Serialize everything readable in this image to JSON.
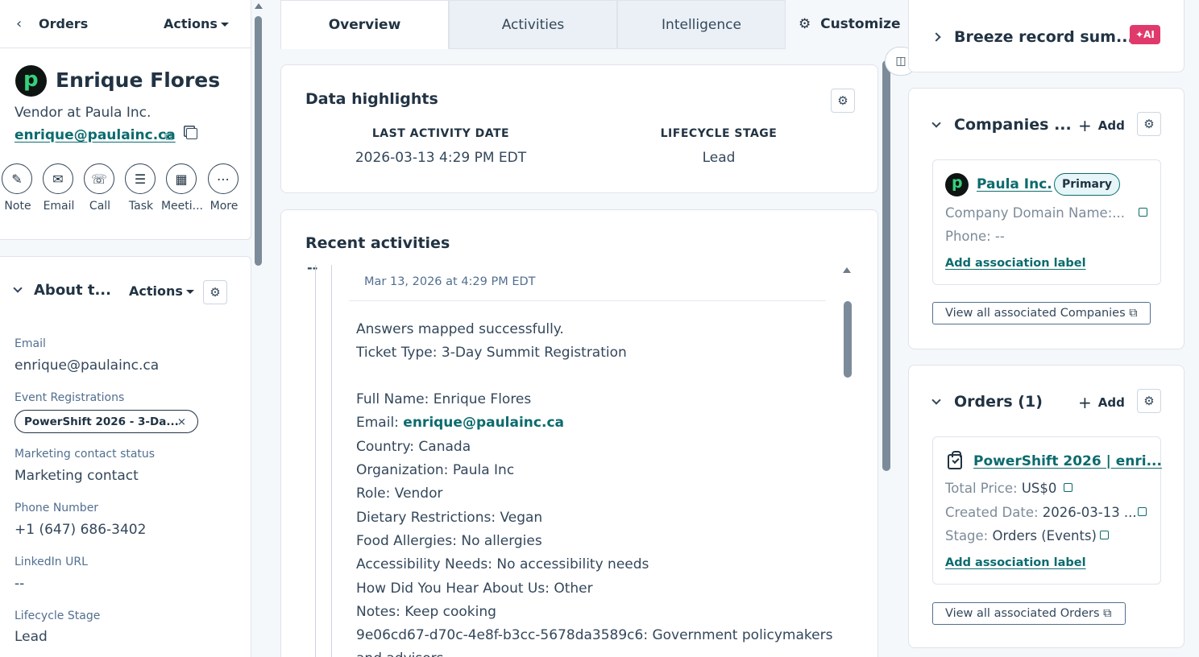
{
  "left": {
    "back_label": "Orders",
    "actions_label": "Actions",
    "contact": {
      "avatar_letter": "p",
      "name": "Enrique Flores",
      "subtitle": "Vendor at Paula Inc.",
      "email": "enrique@paulainc.ca"
    },
    "quick_actions": [
      {
        "label": "Note",
        "icon": "note-icon",
        "glyph": "✎"
      },
      {
        "label": "Email",
        "icon": "envelope-icon",
        "glyph": "✉"
      },
      {
        "label": "Call",
        "icon": "phone-icon",
        "glyph": "☏"
      },
      {
        "label": "Task",
        "icon": "task-list-icon",
        "glyph": "☰"
      },
      {
        "label": "Meeti...",
        "icon": "calendar-icon",
        "glyph": "▦"
      },
      {
        "label": "More",
        "icon": "more-dots-icon",
        "glyph": "⋯"
      }
    ],
    "about": {
      "title": "About t...",
      "actions_label": "Actions",
      "properties": {
        "email_label": "Email",
        "email_value": "enrique@paulainc.ca",
        "event_label": "Event Registrations",
        "event_tag": "PowerShift 2026 - 3-Da...",
        "marketing_label": "Marketing contact status",
        "marketing_value": "Marketing contact",
        "phone_label": "Phone Number",
        "phone_value": "+1 (647) 686-3402",
        "linkedin_label": "LinkedIn URL",
        "linkedin_value": "--",
        "lifecycle_label": "Lifecycle Stage",
        "lifecycle_value": "Lead"
      }
    }
  },
  "tabs": [
    {
      "label": "Overview",
      "active": true
    },
    {
      "label": "Activities",
      "active": false
    },
    {
      "label": "Intelligence",
      "active": false
    }
  ],
  "customize_label": "Customize",
  "highlights": {
    "title": "Data highlights",
    "last_activity_label": "LAST ACTIVITY DATE",
    "last_activity_value": "2026-03-13 4:29 PM EDT",
    "lifecycle_label": "LIFECYCLE STAGE",
    "lifecycle_value": "Lead"
  },
  "recent": {
    "title": "Recent activities",
    "dash": "--",
    "date": "Mar 13, 2026 at 4:29 PM EDT",
    "line1": "Answers mapped successfully.",
    "line2": "Ticket Type: 3-Day Summit Registration",
    "full_name": "Full Name: Enrique Flores",
    "email_prefix": "Email: ",
    "email_value": "enrique@paulainc.ca",
    "country": "Country: Canada",
    "organization": "Organization: Paula Inc",
    "role": "Role: Vendor",
    "dietary": "Dietary Restrictions: Vegan",
    "allergies": "Food Allergies: No allergies",
    "accessibility": "Accessibility Needs: No accessibility needs",
    "hear": "How Did You Hear About Us: Other",
    "notes": "Notes: Keep cooking",
    "uuid_line": "9e06cd67-d70c-4e8f-b3cc-5678da3589c6: Government policymakers",
    "wrap_line": "and advisors"
  },
  "right": {
    "breeze_title": "Breeze record sum...",
    "ai_badge": "✦AI",
    "companies": {
      "title": "Companies ...",
      "add_label": "Add",
      "company_name": "Paula Inc.",
      "primary_label": "Primary",
      "domain_line": "Company Domain Name:...",
      "phone_line": "Phone: --",
      "assoc_label": "Add association label",
      "view_all": "View all associated Companies"
    },
    "orders": {
      "title": "Orders (1)",
      "add_label": "Add",
      "order_name": "PowerShift 2026 | enri...",
      "price_label": "Total Price: ",
      "price_value": "US$0",
      "created_label": "Created Date: ",
      "created_value": "2026-03-13 ...",
      "stage_label": "Stage: ",
      "stage_value": "Orders (Events)",
      "assoc_label": "Add association label",
      "view_all": "View all associated Orders"
    }
  }
}
